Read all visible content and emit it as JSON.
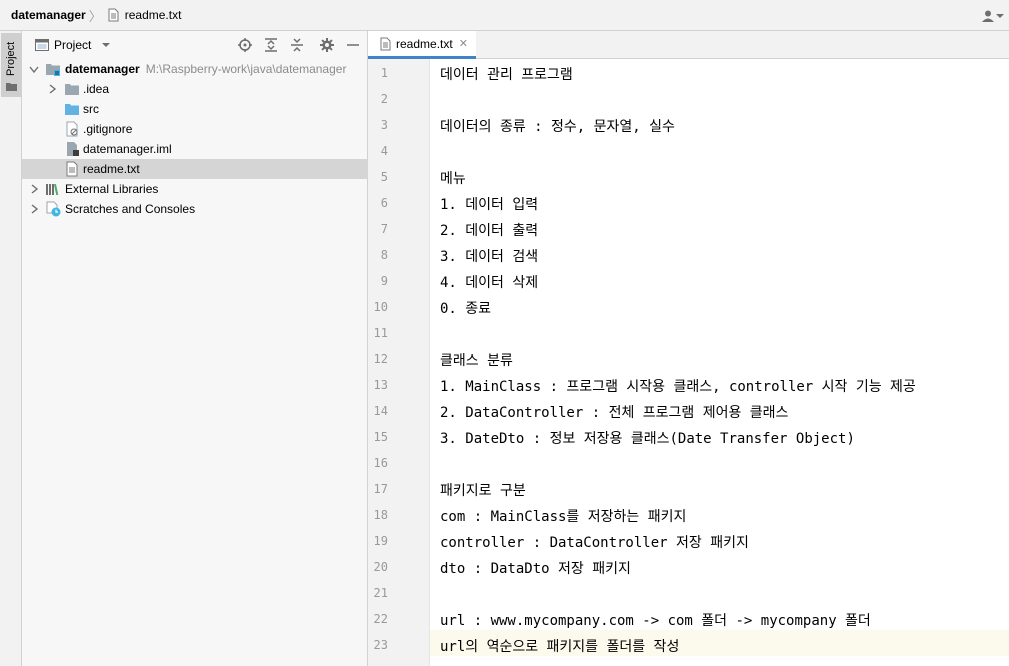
{
  "navbar": {
    "project": "datemanager",
    "file": "readme.txt"
  },
  "stripe": {
    "project_tab": "Project"
  },
  "project_panel": {
    "title": "Project",
    "tree": [
      {
        "label": "datemanager",
        "path": "M:\\Raspberry-work\\java\\datemanager",
        "level": 0,
        "expanded": true,
        "icon": "module-folder-icon"
      },
      {
        "label": ".idea",
        "level": 1,
        "expanded": false,
        "icon": "folder-icon"
      },
      {
        "label": "src",
        "level": 1,
        "icon": "source-folder-icon"
      },
      {
        "label": ".gitignore",
        "level": 1,
        "icon": "gitignore-file-icon"
      },
      {
        "label": "datemanager.iml",
        "level": 1,
        "icon": "iml-file-icon"
      },
      {
        "label": "readme.txt",
        "level": 1,
        "selected": true,
        "icon": "text-file-icon"
      },
      {
        "label": "External Libraries",
        "level": 0,
        "expanded": false,
        "icon": "libraries-icon"
      },
      {
        "label": "Scratches and Consoles",
        "level": 0,
        "expanded": false,
        "icon": "scratches-icon"
      }
    ]
  },
  "editor": {
    "tab": "readme.txt",
    "current_line": 23,
    "lines": [
      "데이터 관리 프로그램",
      "",
      "데이터의 종류 : 정수, 문자열, 실수",
      "",
      "메뉴",
      "1. 데이터 입력",
      "2. 데이터 출력",
      "3. 데이터 검색",
      "4. 데이터 삭제",
      "0. 종료",
      "",
      "클래스 분류",
      "1. MainClass : 프로그램 시작용 클래스, controller 시작 기능 제공",
      "2. DataController : 전체 프로그램 제어용 클래스",
      "3. DateDto : 정보 저장용 클래스(Date Transfer Object)",
      "",
      "패키지로 구분",
      "com : MainClass를 저장하는 패키지",
      "controller : DataController 저장 패키지",
      "dto : DataDto 저장 패키지",
      "",
      "url : www.mycompany.com -> com 폴더 -> mycompany 폴더",
      "url의 역순으로 패키지를 폴더를 작성"
    ]
  }
}
